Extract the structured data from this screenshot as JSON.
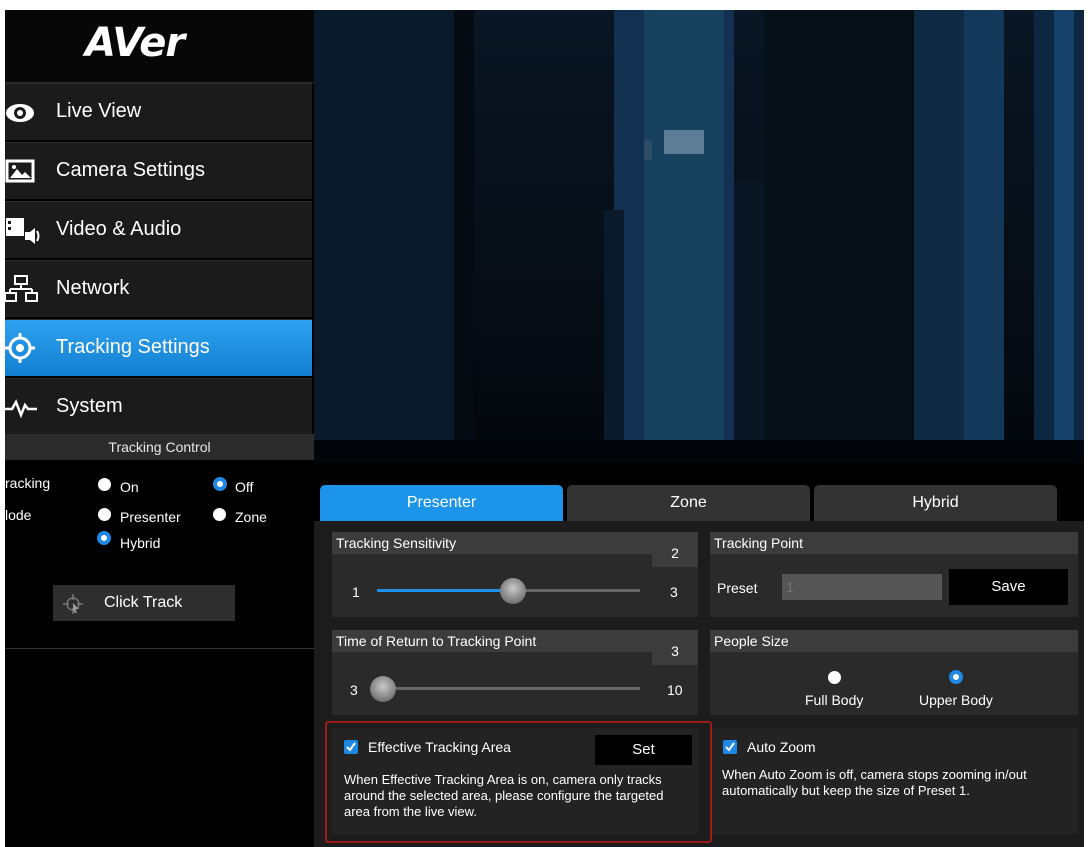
{
  "logo": "AVer",
  "nav": [
    {
      "label": "Live View",
      "icon": "eye-icon"
    },
    {
      "label": "Camera Settings",
      "icon": "image-icon"
    },
    {
      "label": "Video & Audio",
      "icon": "video-audio-icon"
    },
    {
      "label": "Network",
      "icon": "network-icon"
    },
    {
      "label": "Tracking Settings",
      "icon": "target-icon",
      "active": true
    },
    {
      "label": "System",
      "icon": "pulse-icon"
    }
  ],
  "tracking_control": {
    "title": "Tracking Control",
    "tracking_label": "racking",
    "mode_label": "lode",
    "on_label": "On",
    "off_label": "Off",
    "presenter_label": "Presenter",
    "zone_label": "Zone",
    "hybrid_label": "Hybrid",
    "tracking_value": "Off",
    "mode_value": "Hybrid",
    "click_track_label": "Click Track"
  },
  "tabs": [
    {
      "label": "Presenter",
      "active": true
    },
    {
      "label": "Zone"
    },
    {
      "label": "Hybrid"
    }
  ],
  "sensitivity": {
    "title": "Tracking Sensitivity",
    "value": "2",
    "min": "1",
    "max": "3",
    "level": 2
  },
  "tracking_point": {
    "title": "Tracking Point",
    "preset_label": "Preset",
    "preset_placeholder": "1",
    "save_label": "Save"
  },
  "return_time": {
    "title": "Time of Return to Tracking Point",
    "value": "3",
    "min": "3",
    "max": "10",
    "level": 3
  },
  "people_size": {
    "title": "People Size",
    "full_body": "Full Body",
    "upper_body": "Upper Body",
    "selected": "Upper Body"
  },
  "effective_area": {
    "label": "Effective Tracking Area",
    "checked": true,
    "set_label": "Set",
    "description": "When Effective Tracking Area is on, camera only tracks around the selected area, please configure the targeted area from the live view."
  },
  "auto_zoom": {
    "label": "Auto Zoom",
    "checked": true,
    "description": "When Auto Zoom is off, camera stops zooming in/out automatically but keep the size of Preset 1."
  },
  "colors": {
    "accent": "#1b94ea",
    "highlight": "#9b1b1b"
  }
}
